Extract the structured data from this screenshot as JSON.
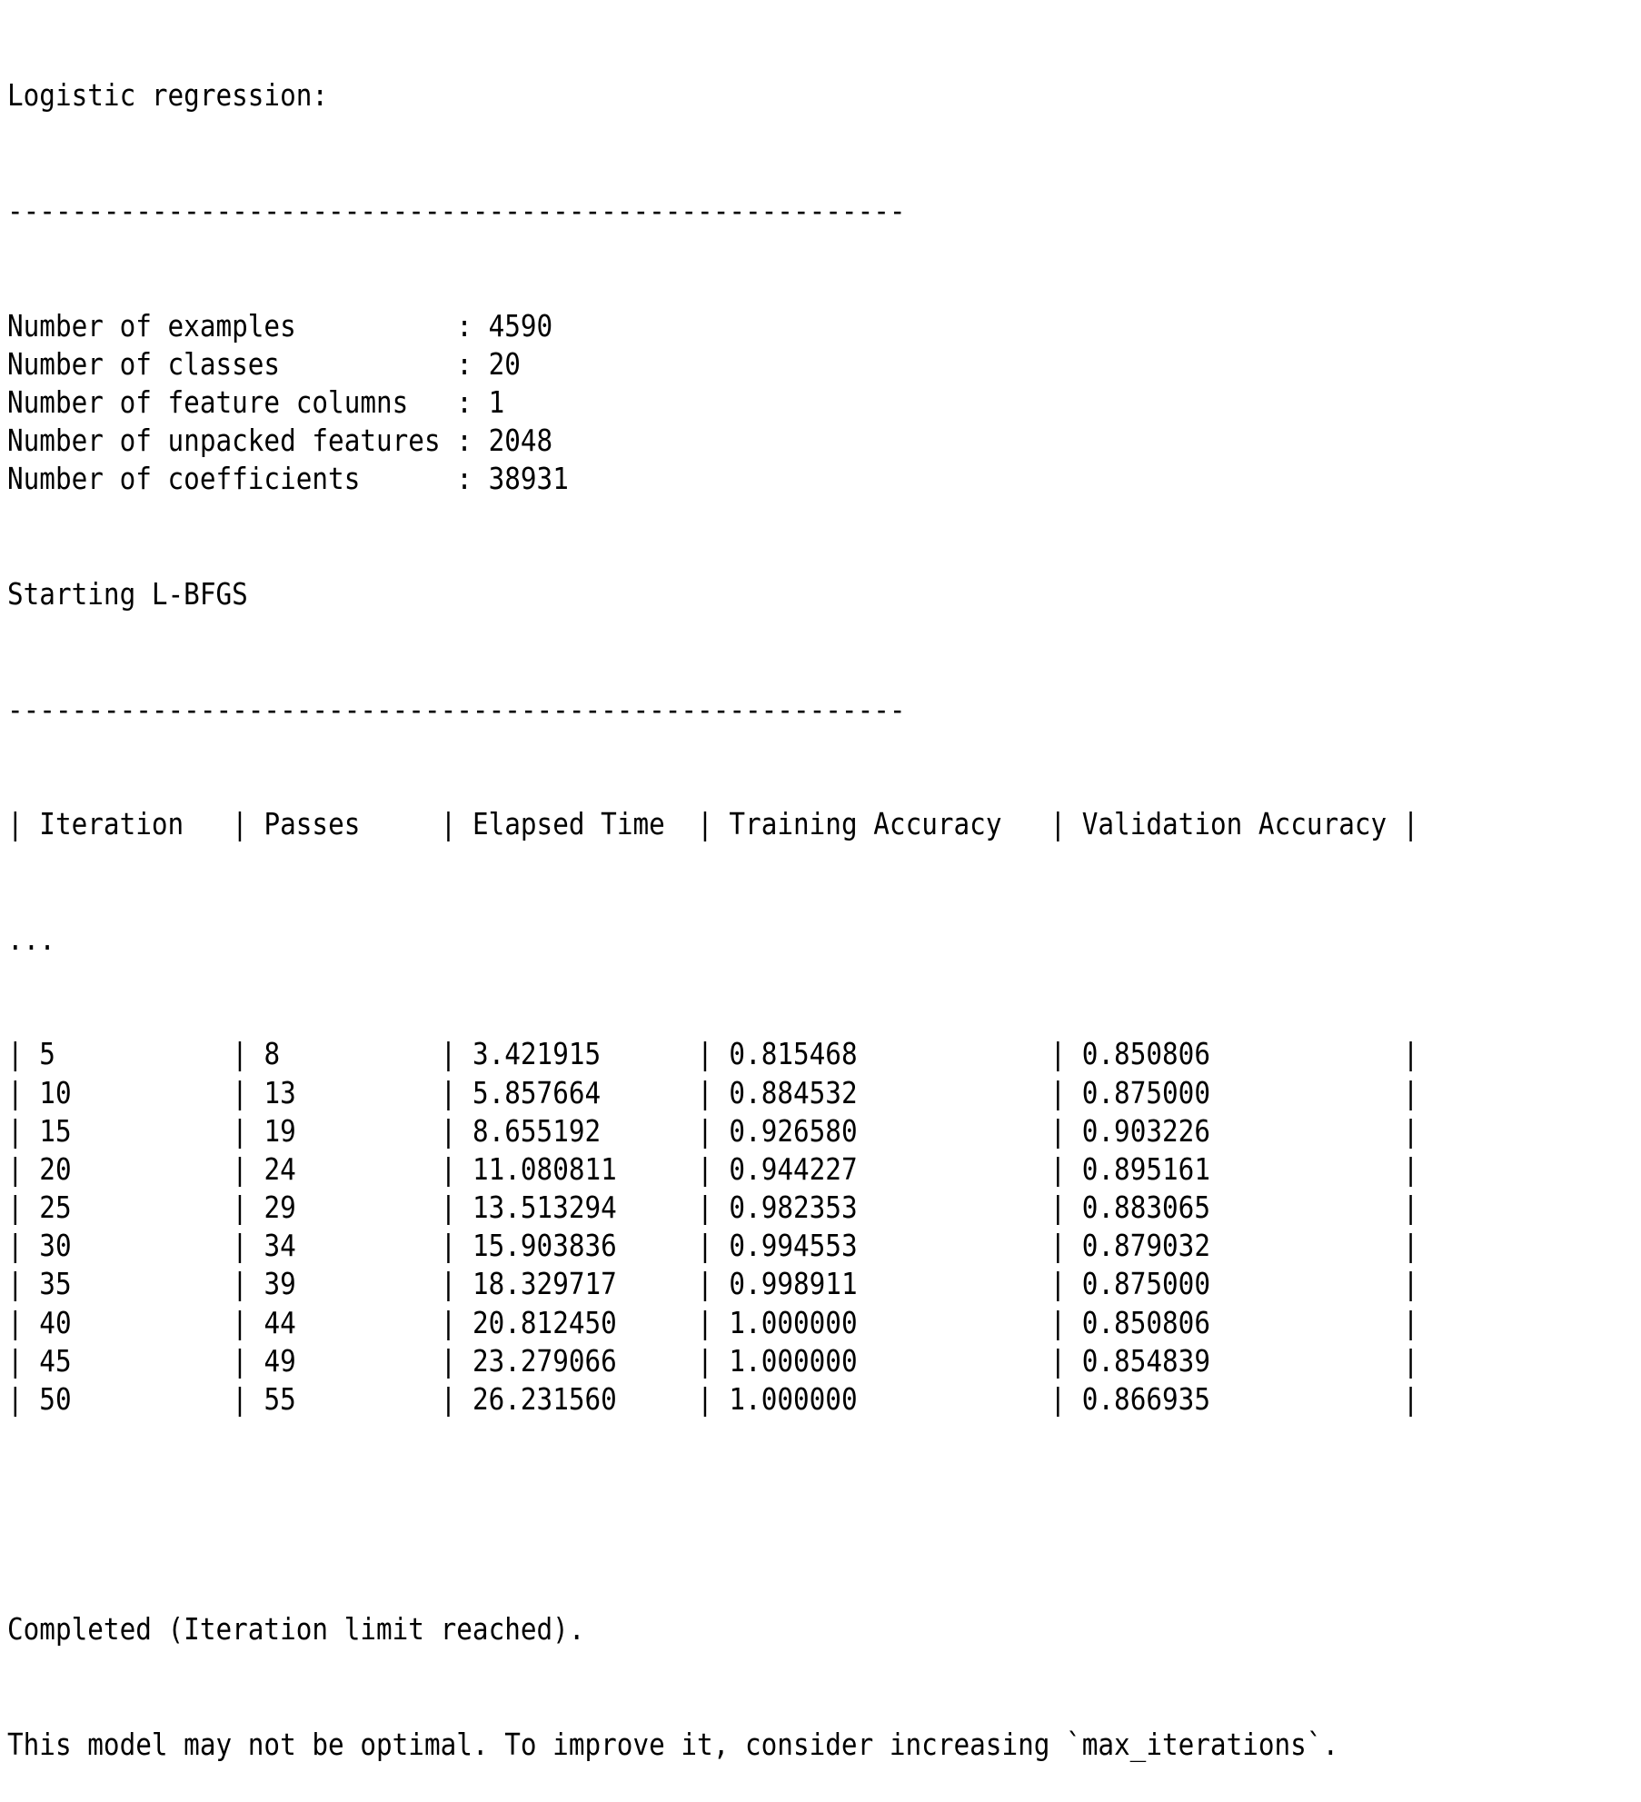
{
  "title": "Logistic regression:",
  "divider": "--------------------------------------------------------",
  "stats": [
    {
      "label": "Number of examples",
      "value": "4590"
    },
    {
      "label": "Number of classes",
      "value": "20"
    },
    {
      "label": "Number of feature columns",
      "value": "1"
    },
    {
      "label": "Number of unpacked features",
      "value": "2048"
    },
    {
      "label": "Number of coefficients",
      "value": "38931"
    }
  ],
  "starting": "Starting L-BFGS",
  "table": {
    "headers": [
      "Iteration",
      "Passes",
      "Elapsed Time",
      "Training Accuracy",
      "Validation Accuracy"
    ],
    "ellipsis": "...",
    "rows": [
      [
        "5",
        "8",
        "3.421915",
        "0.815468",
        "0.850806"
      ],
      [
        "10",
        "13",
        "5.857664",
        "0.884532",
        "0.875000"
      ],
      [
        "15",
        "19",
        "8.655192",
        "0.926580",
        "0.903226"
      ],
      [
        "20",
        "24",
        "11.080811",
        "0.944227",
        "0.895161"
      ],
      [
        "25",
        "29",
        "13.513294",
        "0.982353",
        "0.883065"
      ],
      [
        "30",
        "34",
        "15.903836",
        "0.994553",
        "0.879032"
      ],
      [
        "35",
        "39",
        "18.329717",
        "0.998911",
        "0.875000"
      ],
      [
        "40",
        "44",
        "20.812450",
        "1.000000",
        "0.850806"
      ],
      [
        "45",
        "49",
        "23.279066",
        "1.000000",
        "0.854839"
      ],
      [
        "50",
        "55",
        "26.231560",
        "1.000000",
        "0.866935"
      ]
    ]
  },
  "completed": "Completed (Iteration limit reached).",
  "advice": "This model may not be optimal. To improve it, consider increasing `max_iterations`."
}
